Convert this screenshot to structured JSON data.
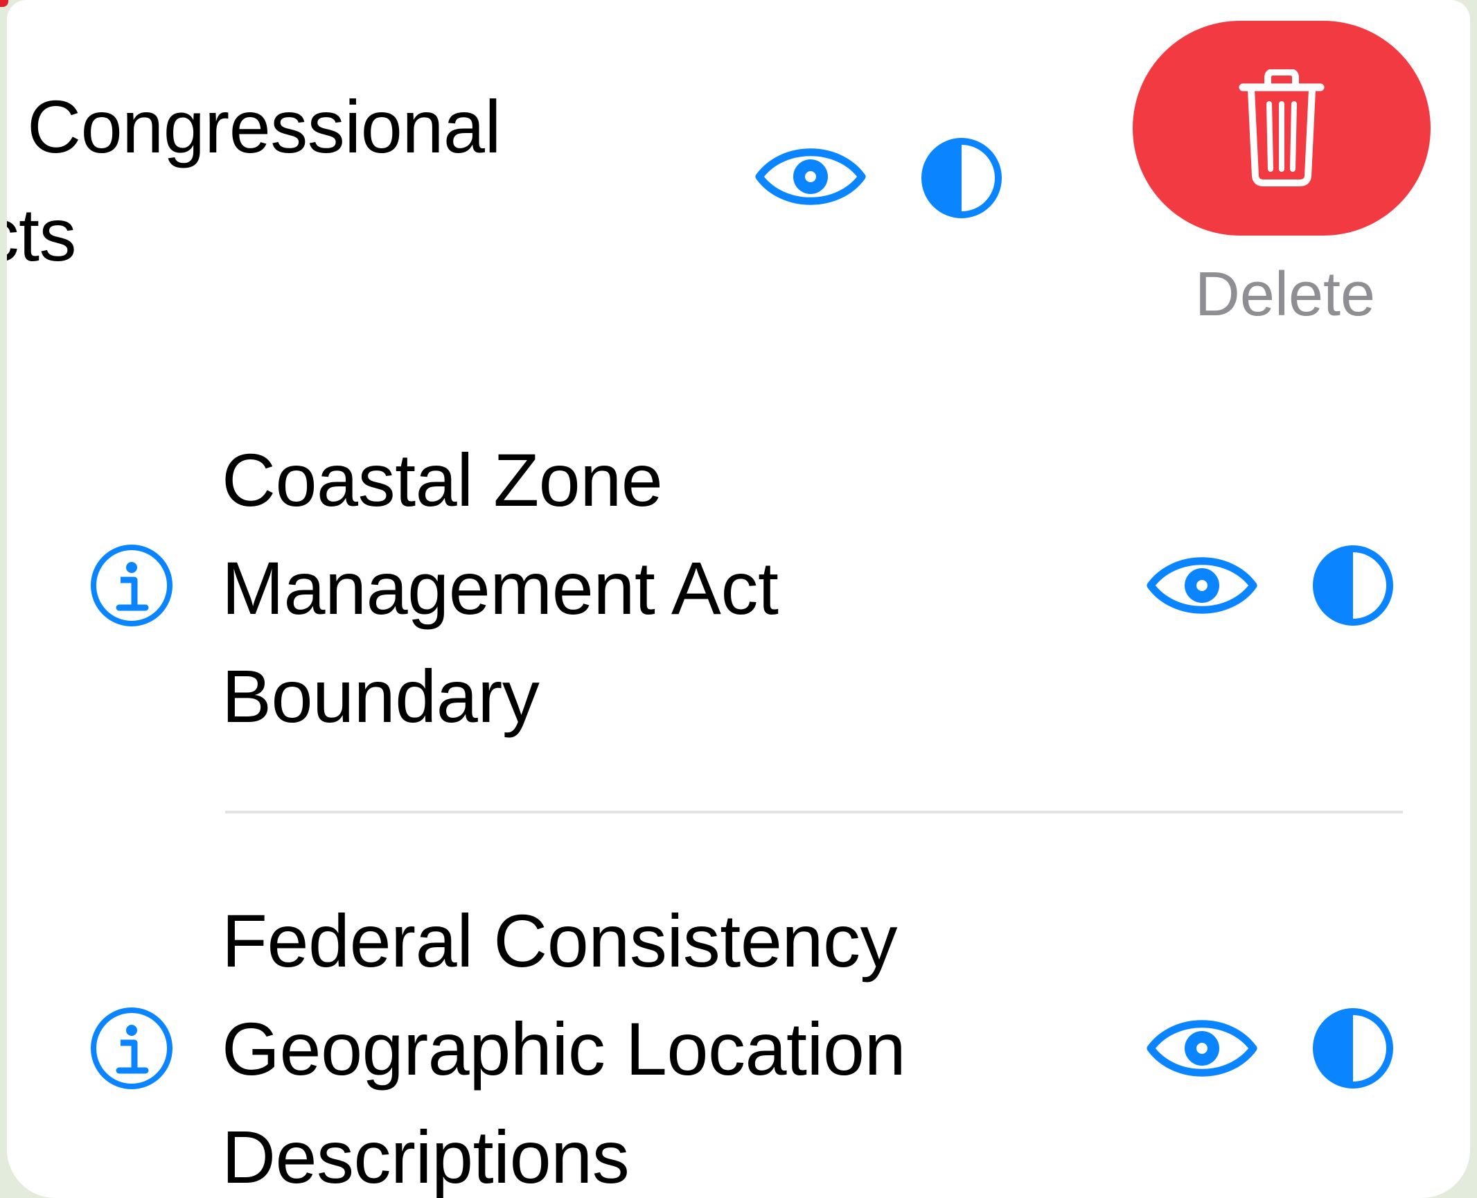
{
  "layers": [
    {
      "title_lines": [
        "n Congressional",
        "icts"
      ],
      "icons": [
        "eye-icon",
        "contrast-icon"
      ]
    },
    {
      "title_lines": [
        "Coastal Zone",
        "Management Act",
        "Boundary"
      ],
      "icons": [
        "info-icon",
        "eye-icon",
        "contrast-icon"
      ]
    },
    {
      "title_lines": [
        "Federal Consistency",
        "Geographic Location",
        "Descriptions"
      ],
      "icons": [
        "info-icon",
        "eye-icon",
        "contrast-icon"
      ]
    }
  ],
  "swipe_action": {
    "label": "Delete",
    "icon": "trash-icon"
  },
  "colors": {
    "accent": "#0a84ff",
    "destructive": "#f23a43",
    "secondary_text": "#8e8e93"
  }
}
